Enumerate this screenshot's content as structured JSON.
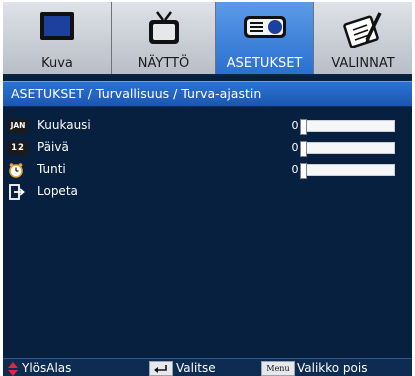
{
  "tabs": [
    {
      "label": "Kuva",
      "icon": "monitor-icon",
      "active": false
    },
    {
      "label": "NÄYTTÖ",
      "icon": "tv-icon",
      "active": false
    },
    {
      "label": "ASETUKSET",
      "icon": "projector-icon",
      "active": true
    },
    {
      "label": "VALINNAT",
      "icon": "notepad-icon",
      "active": false
    }
  ],
  "breadcrumb": "ASETUKSET / Turvallisuus / Turva-ajastin",
  "rows": [
    {
      "label": "Kuukausi",
      "icon": "month-calendar-icon",
      "badge": "JAN",
      "value": "0",
      "level": 0
    },
    {
      "label": "Päivä",
      "icon": "day-calendar-icon",
      "badge": "12",
      "value": "0",
      "level": 0
    },
    {
      "label": "Tunti",
      "icon": "clock-icon",
      "value": "0",
      "level": 0
    },
    {
      "label": "Lopeta",
      "icon": "exit-icon"
    }
  ],
  "footer": {
    "nav_label": "YlösAlas",
    "select_label": "Valitse",
    "menu_key": "Menu",
    "menu_label": "Valikko pois"
  },
  "colors": {
    "background": "#08203f",
    "accent": "#2a74d5",
    "tab_inactive": "#c9cdd4",
    "nav_arrows": "#e0283b"
  }
}
